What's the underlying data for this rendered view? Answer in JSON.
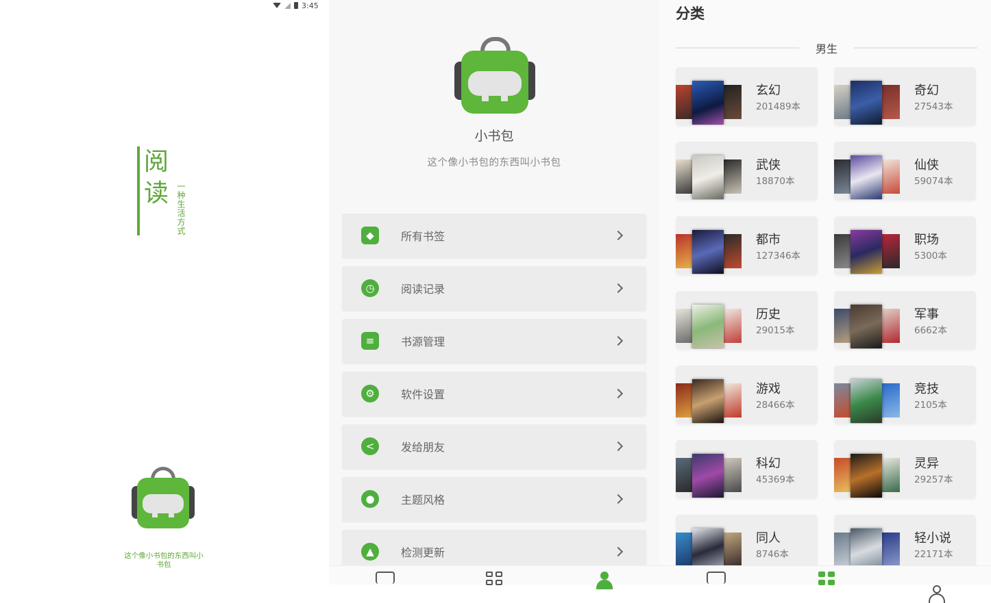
{
  "status_bar": {
    "time": "3:45"
  },
  "splash": {
    "title_chars": [
      "阅",
      "读"
    ],
    "subtitle": "一种生活方式",
    "tagline": "这个像小书包的东西叫小书包"
  },
  "profile": {
    "name": "小书包",
    "description": "这个像小书包的东西叫小书包",
    "menu": [
      {
        "label": "所有书签",
        "icon": "tag-icon"
      },
      {
        "label": "阅读记录",
        "icon": "clock-icon"
      },
      {
        "label": "书源管理",
        "icon": "database-icon"
      },
      {
        "label": "软件设置",
        "icon": "gear-icon"
      },
      {
        "label": "发给朋友",
        "icon": "share-icon"
      },
      {
        "label": "主题风格",
        "icon": "palette-icon"
      },
      {
        "label": "检测更新",
        "icon": "cloud-upload-icon"
      }
    ]
  },
  "categories": {
    "title": "分类",
    "section": "男生",
    "items": [
      {
        "name": "玄幻",
        "count": "201489本"
      },
      {
        "name": "奇幻",
        "count": "27543本"
      },
      {
        "name": "武侠",
        "count": "18870本"
      },
      {
        "name": "仙侠",
        "count": "59074本"
      },
      {
        "name": "都市",
        "count": "127346本"
      },
      {
        "name": "职场",
        "count": "5300本"
      },
      {
        "name": "历史",
        "count": "29015本"
      },
      {
        "name": "军事",
        "count": "6662本"
      },
      {
        "name": "游戏",
        "count": "28466本"
      },
      {
        "name": "竞技",
        "count": "2105本"
      },
      {
        "name": "科幻",
        "count": "45369本"
      },
      {
        "name": "灵异",
        "count": "29257本"
      },
      {
        "name": "同人",
        "count": "8746本"
      },
      {
        "name": "轻小说",
        "count": "22171本"
      }
    ]
  },
  "colors": {
    "accent": "#4faf3e",
    "brand_green": "#5fa83b"
  }
}
